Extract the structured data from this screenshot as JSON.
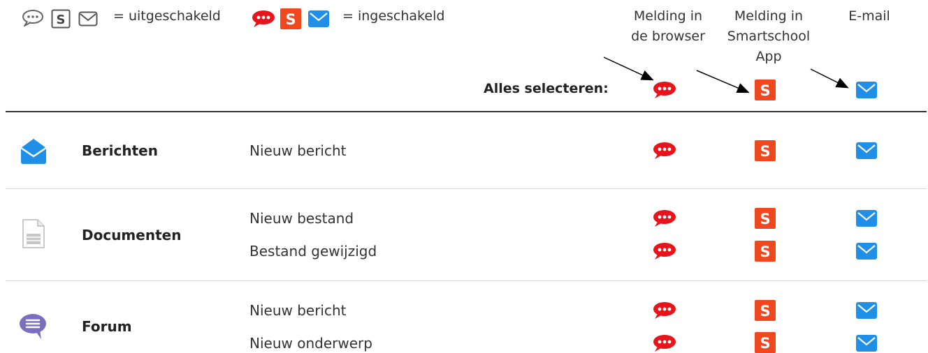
{
  "legend": {
    "off_icons": [
      "comment-outline-icon",
      "smartschool-outline-icon",
      "mail-outline-icon"
    ],
    "off_text": "= uitgeschakeld",
    "on_icons": [
      "comment-filled-icon",
      "smartschool-filled-icon",
      "mail-filled-icon"
    ],
    "on_text": "= ingeschakeld"
  },
  "columns": {
    "browser": "Melding in\nde browser",
    "app": "Melding in\nSmartschool\nApp",
    "email": "E-mail"
  },
  "select_all": {
    "label": "Alles selecteren:"
  },
  "modules": [
    {
      "name": "Berichten",
      "icon": "envelope-open-icon",
      "rows": [
        {
          "label": "Nieuw bericht"
        }
      ]
    },
    {
      "name": "Documenten",
      "icon": "document-icon",
      "rows": [
        {
          "label": "Nieuw bestand"
        },
        {
          "label": "Bestand gewijzigd"
        }
      ]
    },
    {
      "name": "Forum",
      "icon": "forum-chat-icon",
      "rows": [
        {
          "label": "Nieuw bericht"
        },
        {
          "label": "Nieuw onderwerp"
        }
      ]
    }
  ],
  "colors": {
    "browser_on": "#e8141c",
    "app_on": "#f0471f",
    "email_on": "#1f8fe8",
    "off": "#555555",
    "forum_icon": "#7a6fbf",
    "berichten_icon": "#1f8fe8"
  }
}
